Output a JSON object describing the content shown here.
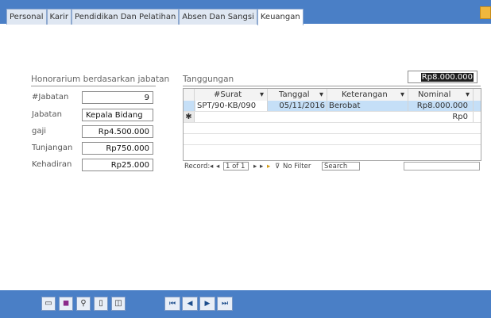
{
  "tabs": [
    "Personal",
    "Karir",
    "Pendidikan Dan Pelatihan",
    "Absen Dan Sangsi",
    "Keuangan"
  ],
  "honor": {
    "header": "Honorarium berdasarkan jabatan",
    "fields": [
      {
        "label": "#Jabatan",
        "value": "9"
      },
      {
        "label": "Jabatan",
        "value": "Kepala Bidang"
      },
      {
        "label": "gaji",
        "value": "Rp4.500.000"
      },
      {
        "label": "Tunjangan",
        "value": "Rp750.000"
      },
      {
        "label": "Kehadiran",
        "value": "Rp25.000"
      }
    ]
  },
  "tanggungan": {
    "header": "Tanggungan",
    "total": "Rp8.000.000",
    "columns": [
      "#Surat",
      "Tanggal",
      "Keterangan",
      "Nominal"
    ],
    "rows": [
      {
        "surat": "SPT/90-KB/090",
        "tanggal": "05/11/2016",
        "keterangan": "Berobat",
        "nominal": "Rp8.000.000"
      }
    ],
    "new_row": {
      "marker": "✱",
      "nominal": "Rp0"
    }
  },
  "navbar": {
    "record_label": "Record:",
    "position": "1 of 1",
    "filter": "No Filter",
    "search": "Search"
  },
  "colors": {
    "accent": "#4a7fc6",
    "selection": "#c5dff7"
  }
}
